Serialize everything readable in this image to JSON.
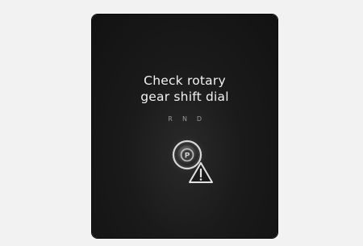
{
  "warning": {
    "line1": "Check rotary",
    "line2": "gear shift dial"
  },
  "gear_selector": {
    "positions": [
      "R",
      "N",
      "D"
    ],
    "center_label": "P"
  },
  "icons": {
    "dial": "rotary-dial-icon",
    "warning": "warning-triangle-icon"
  },
  "colors": {
    "panel": "#1a1a1a",
    "text": "#f2f2f2",
    "background": "#f2f2f2"
  }
}
